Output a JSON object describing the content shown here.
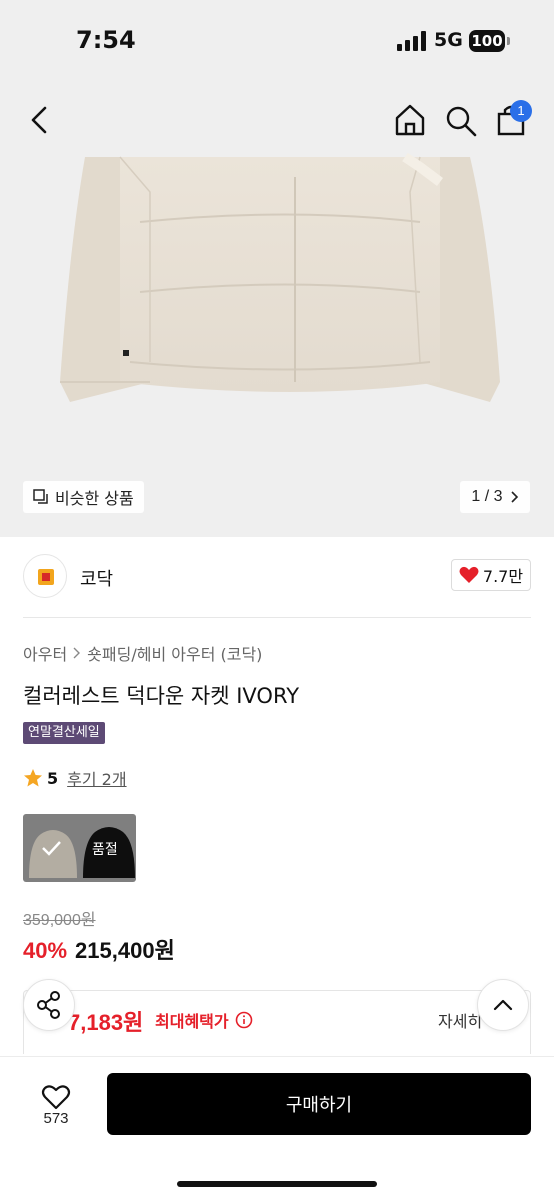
{
  "status_bar": {
    "time": "7:54",
    "network": "5G",
    "battery": "100"
  },
  "header": {
    "cart_count": "1"
  },
  "gallery": {
    "similar_label": "비슷한 상품",
    "page_indicator": "1 / 3"
  },
  "brand": {
    "name": "코닥",
    "likes": "7.7만"
  },
  "product": {
    "breadcrumb": [
      "아우터",
      "숏패딩/헤비 아우터 (코닥)"
    ],
    "title": "컬러레스트 덕다운 자켓 IVORY",
    "sale_tag": "연말결산세일",
    "rating": "5",
    "review_link": "후기 2개",
    "soldout_label": "품절",
    "original_price": "359,000원",
    "discount": "40%",
    "price": "215,400원",
    "max_benefit_price": "7,183원",
    "max_benefit_label": "최대혜택가",
    "detail_link": "자세히"
  },
  "bottom_bar": {
    "wish_count": "573",
    "buy_label": "구매하기"
  },
  "colors": {
    "accent_red": "#e5202a",
    "sale_tag_bg": "#5d4a75",
    "badge_blue": "#2a6fe8"
  }
}
